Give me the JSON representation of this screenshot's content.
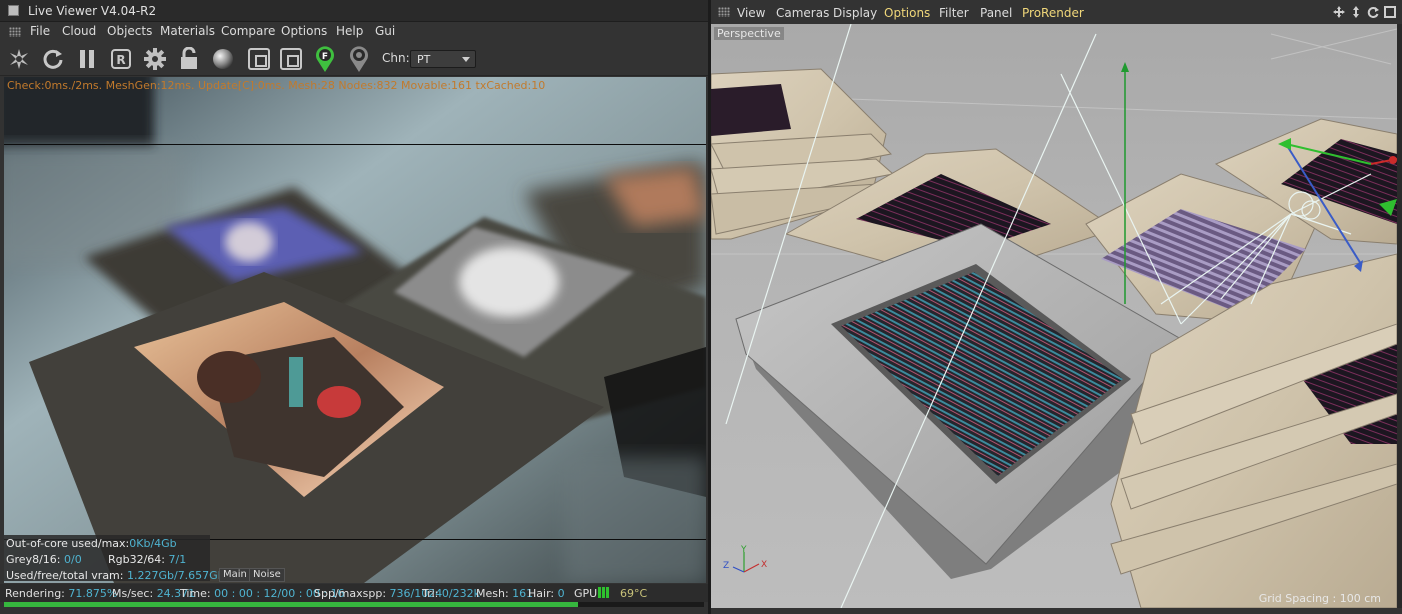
{
  "live_viewer": {
    "title": "Live Viewer V4.04-R2",
    "menu": [
      "File",
      "Cloud",
      "Objects",
      "Materials",
      "Compare",
      "Options",
      "Help",
      "Gui"
    ],
    "toolbar_icons": [
      "send-scene-icon",
      "restart-icon",
      "pause-icon",
      "region-render-icon",
      "settings-gear-icon",
      "lock-icon",
      "material-sphere-icon",
      "render-region-icon",
      "film-region-icon",
      "focus-picker-icon",
      "material-picker-icon"
    ],
    "focus_badge": "F",
    "channel_label": "Chn:",
    "channel_value": "PT",
    "stats_line": "Check:0ms./2ms. MeshGen:12ms. Update[C]:0ms. Mesh:28 Nodes:832 Movable:161 txCached:10",
    "overlay": {
      "ooc_label": "Out-of-core used/max:",
      "ooc_value": "0Kb/4Gb",
      "grey_label": "Grey8/16:",
      "grey_value": "0/0",
      "rgb_label": "Rgb32/64:",
      "rgb_value": "7/1",
      "vram_label": "Used/free/total vram:",
      "vram_value": "1.227Gb/7.657Gb/11Gb",
      "tab_main": "Main",
      "tab_noise": "Noise"
    },
    "status": {
      "rendering_label": "Rendering:",
      "rendering_value": "71.875%",
      "ms_label": "Ms/sec:",
      "ms_value": "24.371",
      "time_label": "Time:",
      "time_value": "00 : 00 : 12/00 : 00 : 16",
      "spp_label": "Spp/maxspp:",
      "spp_value": "736/1024",
      "tri_label": "Tri:",
      "tri_value": "0/232k",
      "mesh_label": "Mesh:",
      "mesh_value": "161",
      "hair_label": "Hair:",
      "hair_value": "0",
      "gpu_label": "GPU:",
      "gpu_temp": "69°C"
    },
    "progress": 0.82
  },
  "viewport": {
    "menu": [
      "View",
      "Cameras",
      "Display",
      "Options",
      "Filter",
      "Panel",
      "ProRender"
    ],
    "highlighted": [
      "Options",
      "ProRender"
    ],
    "nav_icons": [
      "move-view-icon",
      "zoom-view-icon",
      "rotate-view-icon",
      "maximize-view-icon"
    ],
    "camera_label": "Perspective",
    "grid_spacing": "Grid Spacing : 100 cm",
    "axis_labels": {
      "y": "Y",
      "z": "Z",
      "x": "X"
    }
  },
  "colors": {
    "accent_orange": "#c27a2c",
    "value_blue": "#4fb3d0",
    "progress_green": "#36b73e",
    "menu_highlight": "#f0d77a"
  }
}
